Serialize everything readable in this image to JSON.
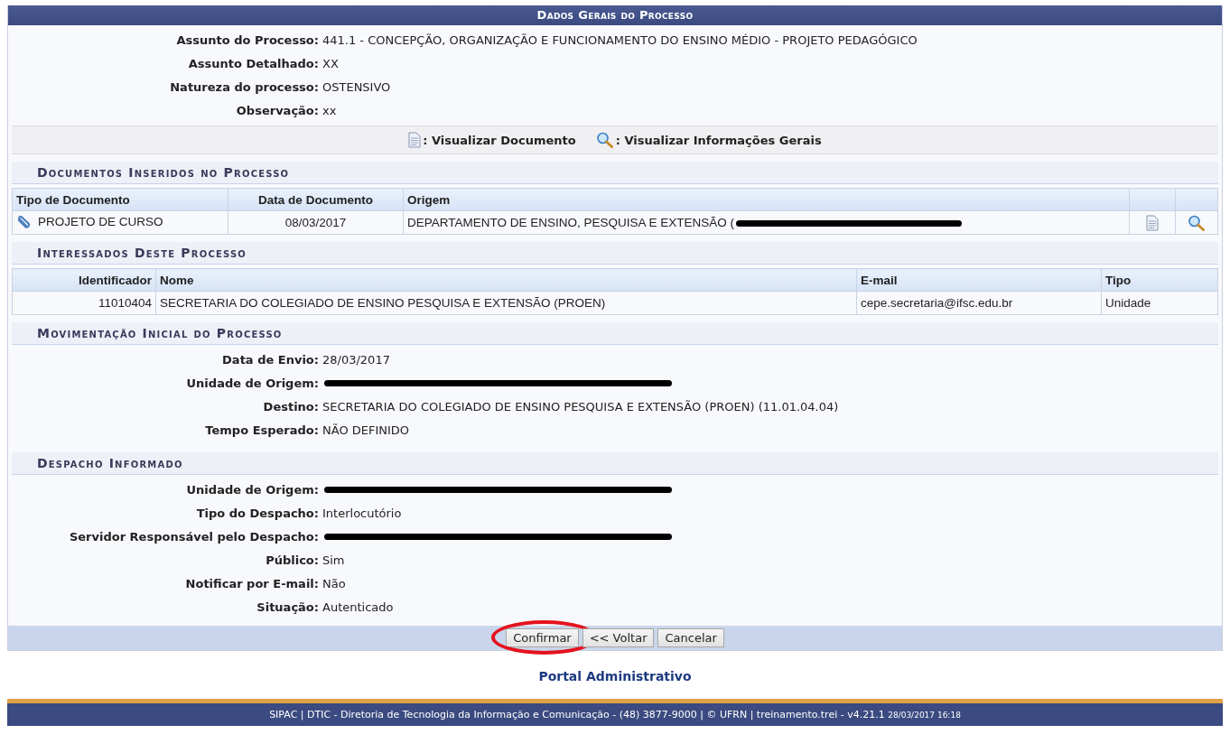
{
  "panel": {
    "title": "Dados Gerais do Processo"
  },
  "general_fields": [
    {
      "label": "Assunto do Processo:",
      "value": "441.1 - CONCEPÇÃO, ORGANIZAÇÃO E FUNCIONAMENTO DO ENSINO MÉDIO - PROJETO PEDAGÓGICO"
    },
    {
      "label": "Assunto Detalhado:",
      "value": "XX"
    },
    {
      "label": "Natureza do processo:",
      "value": "OSTENSIVO"
    },
    {
      "label": "Observação:",
      "value": "xx"
    }
  ],
  "legend": [
    {
      "kind": "document",
      "text": ": Visualizar Documento"
    },
    {
      "kind": "search",
      "text": ": Visualizar Informações Gerais"
    }
  ],
  "documents": {
    "title": "Documentos Inseridos no Processo",
    "columns": [
      "Tipo de Documento",
      "Data de Documento",
      "Origem"
    ],
    "rows": [
      {
        "type": "PROJETO DE CURSO",
        "date": "08/03/2017",
        "origin": "DEPARTAMENTO DE ENSINO, PESQUISA E EXTENSÃO (",
        "redacted": true
      }
    ]
  },
  "interested": {
    "title": "Interessados Deste Processo",
    "columns": [
      "Identificador",
      "Nome",
      "E-mail",
      "Tipo"
    ],
    "rows": [
      [
        "11010404",
        "SECRETARIA DO COLEGIADO DE ENSINO PESQUISA E EXTENSÃO (PROEN)",
        "cepe.secretaria@ifsc.edu.br",
        "Unidade"
      ]
    ]
  },
  "movement": {
    "title": "Movimentação Inicial do Processo",
    "fields": [
      {
        "label": "Data de Envio:",
        "kind": "text",
        "value": "28/03/2017"
      },
      {
        "label": "Unidade de Origem:",
        "kind": "redacted"
      },
      {
        "label": "Destino:",
        "kind": "text",
        "value": "SECRETARIA DO COLEGIADO DE ENSINO PESQUISA E EXTENSÃO (PROEN) (11.01.04.04)"
      },
      {
        "label": "Tempo Esperado:",
        "kind": "text",
        "value": "NÃO DEFINIDO"
      }
    ]
  },
  "dispatch": {
    "title": "Despacho Informado",
    "fields": [
      {
        "label": "Unidade de Origem:",
        "kind": "redacted"
      },
      {
        "label": "Tipo do Despacho:",
        "kind": "text",
        "value": "Interlocutório"
      },
      {
        "label": "Servidor Responsável pelo Despacho:",
        "kind": "redacted"
      },
      {
        "label": "Público:",
        "kind": "text",
        "value": "Sim"
      },
      {
        "label": "Notificar por E-mail:",
        "kind": "text",
        "value": "Não"
      },
      {
        "label": "Situação:",
        "kind": "text",
        "value": "Autenticado"
      }
    ]
  },
  "buttons": [
    {
      "label": "Confirmar",
      "circled": true
    },
    {
      "label": "<< Voltar",
      "circled": false
    },
    {
      "label": "Cancelar",
      "circled": false
    }
  ],
  "portal_link": "Portal Administrativo",
  "footer": {
    "text": "SIPAC | DTIC - Diretoria de Tecnologia da Informação e Comunicação - (48) 3877-9000 | © UFRN | treinamento.trei - v4.21.1",
    "timestamp": "28/03/2017 16:18"
  }
}
